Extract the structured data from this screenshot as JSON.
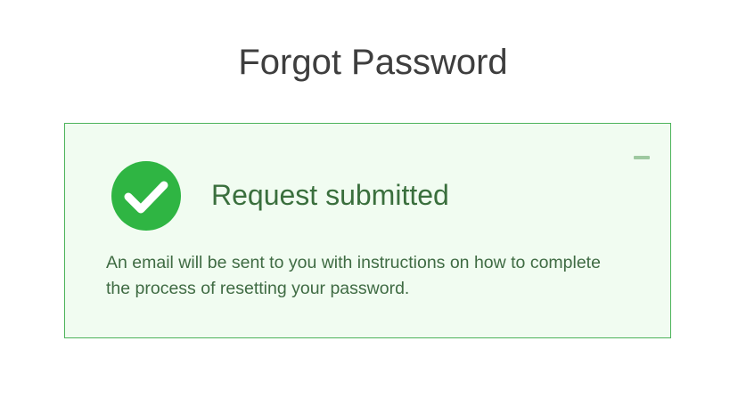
{
  "page": {
    "title": "Forgot Password"
  },
  "alert": {
    "heading": "Request submitted",
    "message": "An email will be sent to you with instructions on how to complete the process of resetting your password.",
    "icon": "check-circle-icon",
    "collapse_icon": "minus-icon"
  },
  "colors": {
    "title_text": "#3e3e3e",
    "alert_background": "#f1fcf1",
    "alert_border": "#4cb35a",
    "success_green": "#2fb543",
    "heading_text": "#3a6f3d",
    "message_text": "#3f6b43",
    "collapse_bar": "#9ec9a0"
  }
}
